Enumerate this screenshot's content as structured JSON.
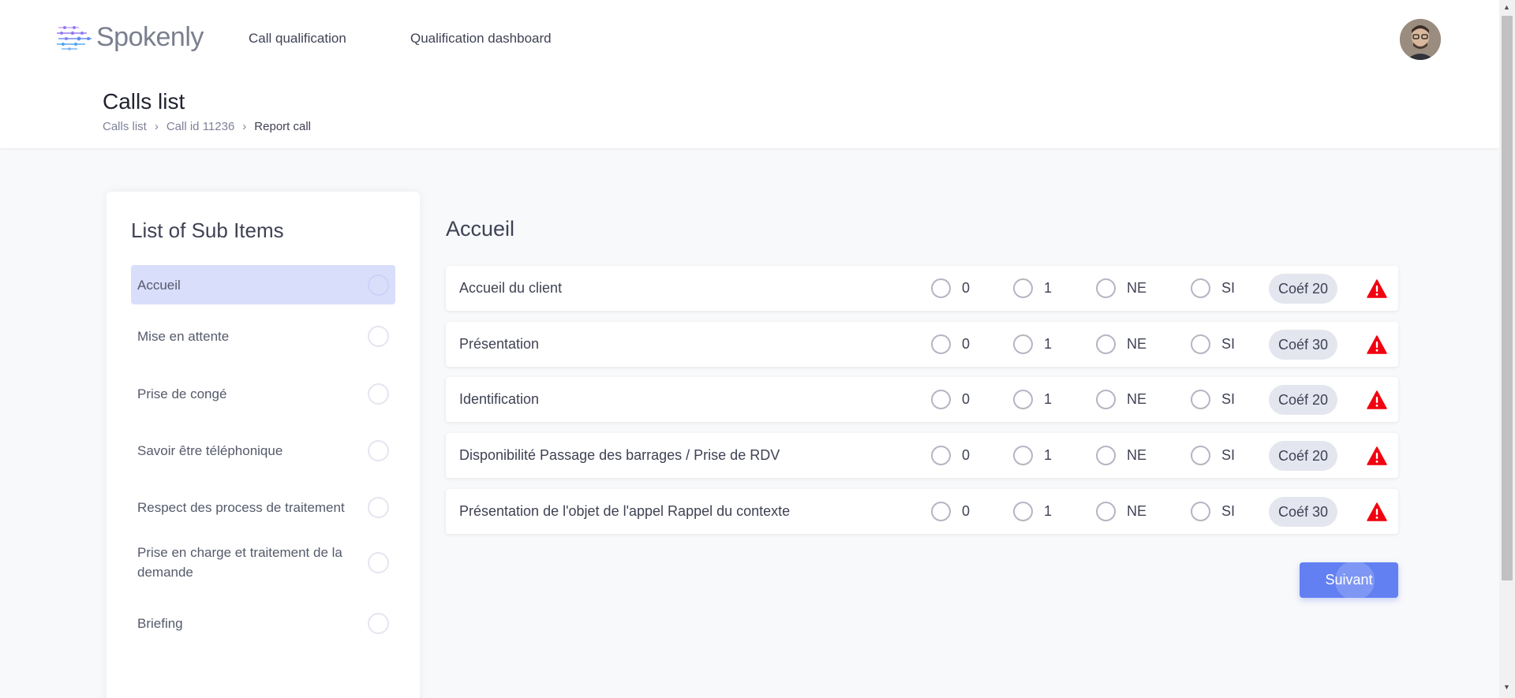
{
  "header": {
    "logo_text": "Spokenly",
    "nav": [
      {
        "label": "Call qualification"
      },
      {
        "label": "Qualification dashboard"
      }
    ],
    "page_title": "Calls list",
    "breadcrumb": [
      "Calls list",
      "Call id 11236",
      "Report call"
    ],
    "breadcrumb_separator": "›"
  },
  "sidebar": {
    "title": "List of Sub Items",
    "items": [
      {
        "label": "Accueil",
        "active": true
      },
      {
        "label": "Mise en attente",
        "active": false
      },
      {
        "label": "Prise de congé",
        "active": false
      },
      {
        "label": "Savoir être téléphonique",
        "active": false
      },
      {
        "label": "Respect des process de traitement",
        "active": false
      },
      {
        "label": "Prise en charge et traitement de la demande",
        "active": false
      },
      {
        "label": "Briefing",
        "active": false
      }
    ]
  },
  "main": {
    "section_title": "Accueil",
    "options": [
      "0",
      "1",
      "NE",
      "SI"
    ],
    "rows": [
      {
        "name": "Accueil du client",
        "coef": "Coéf 20"
      },
      {
        "name": "Présentation",
        "coef": "Coéf 30"
      },
      {
        "name": "Identification",
        "coef": "Coéf 20"
      },
      {
        "name": "Disponibilité Passage des barrages / Prise de RDV",
        "coef": "Coéf 20"
      },
      {
        "name": "Présentation de l'objet de l'appel Rappel du contexte",
        "coef": "Coéf 30"
      }
    ],
    "next_label": "Suivant"
  },
  "icons": {
    "logo": "spokenly-logo-icon",
    "avatar": "user-avatar",
    "warning": "warning-triangle-icon",
    "scroll_up": "scroll-up-arrow-icon",
    "scroll_down": "scroll-down-arrow-icon"
  },
  "colors": {
    "accent": "#6380f2",
    "active_item_bg": "#d9defb",
    "warning": "#f1000f",
    "coef_badge_bg": "#e4e6ef"
  }
}
